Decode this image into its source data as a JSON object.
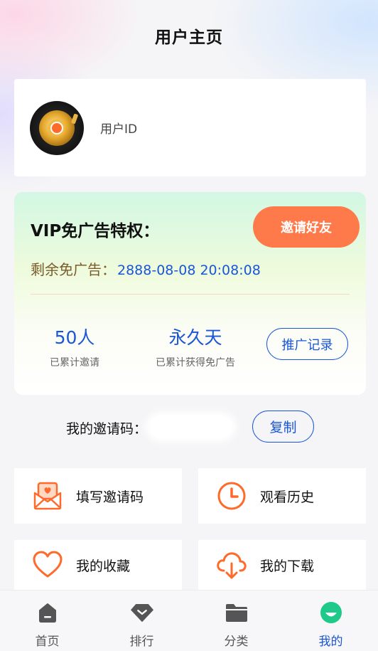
{
  "header": {
    "title": "用户主页"
  },
  "user": {
    "id_label": "用户ID",
    "avatar_icon": "gold-coin-avatar-icon"
  },
  "vip": {
    "title": "VIP免广告特权：",
    "invite_button": "邀请好友",
    "remaining_label": "剩余免广告：",
    "remaining_value": "2888-08-08 20:08:08",
    "stat_invited_value": "50人",
    "stat_invited_label": "已累计邀请",
    "stat_free_value": "永久天",
    "stat_free_label": "已累计获得免广告",
    "promo_button": "推广记录"
  },
  "invite_code": {
    "label": "我的邀请码：",
    "value": "",
    "copy_button": "复制"
  },
  "tiles": [
    {
      "label": "填写邀请码",
      "icon": "envelope-heart-icon"
    },
    {
      "label": "观看历史",
      "icon": "clock-icon"
    },
    {
      "label": "我的收藏",
      "icon": "heart-icon"
    },
    {
      "label": "我的下载",
      "icon": "cloud-download-icon"
    }
  ],
  "tabbar": {
    "active": "我的",
    "items": [
      {
        "label": "首页",
        "icon": "home-icon"
      },
      {
        "label": "排行",
        "icon": "ranking-diamond-icon"
      },
      {
        "label": "分类",
        "icon": "folder-icon"
      },
      {
        "label": "我的",
        "icon": "profile-smile-icon"
      }
    ]
  },
  "colors": {
    "accent_blue": "#1a56d6",
    "accent_orange": "#ff7a4a",
    "vip_green": "#d2f7e4"
  }
}
